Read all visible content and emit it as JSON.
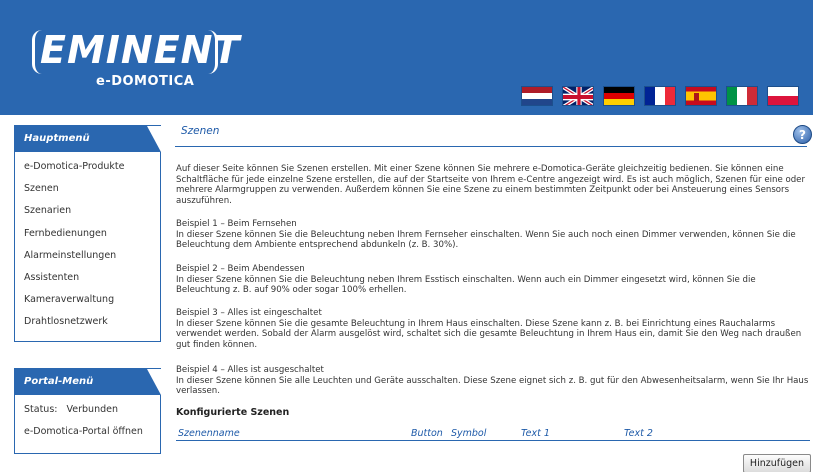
{
  "brand": {
    "logo_word": "EMINENT",
    "logo_sub": "e-DOMOTICA"
  },
  "flags": [
    {
      "name": "nl-flag"
    },
    {
      "name": "uk-flag"
    },
    {
      "name": "de-flag"
    },
    {
      "name": "fr-flag"
    },
    {
      "name": "es-flag"
    },
    {
      "name": "it-flag"
    },
    {
      "name": "pl-flag"
    }
  ],
  "main_menu": {
    "title": "Hauptmenü",
    "items": [
      "e-Domotica-Produkte",
      "Szenen",
      "Szenarien",
      "Fernbedienungen",
      "Alarmeinstellungen",
      "Assistenten",
      "Kameraverwaltung",
      "Drahtlosnetzwerk"
    ]
  },
  "portal_menu": {
    "title": "Portal-Menü",
    "status_label": "Status:",
    "status_value": "Verbunden",
    "open_portal": "e-Domotica-Portal öffnen"
  },
  "page": {
    "title": "Szenen",
    "help_icon": "?",
    "intro": "Auf dieser Seite können Sie Szenen erstellen. Mit einer Szene können Sie mehrere e-Domotica-Geräte gleichzeitig bedienen. Sie können eine Schaltfläche für jede einzelne Szene erstellen, die auf der Startseite von Ihrem e-Centre angezeigt wird. Es ist auch möglich, Szenen für eine oder mehrere Alarmgruppen zu verwenden. Außerdem können Sie eine Szene zu einem bestimmten Zeitpunkt oder bei Ansteuerung eines Sensors auszuführen.",
    "examples": [
      {
        "heading": "Beispiel 1 – Beim Fernsehen",
        "text": "In dieser Szene können Sie die Beleuchtung neben Ihrem Fernseher einschalten. Wenn Sie auch noch einen Dimmer verwenden, können Sie die Beleuchtung dem Ambiente entsprechend abdunkeln (z. B. 30%)."
      },
      {
        "heading": "Beispiel 2 – Beim Abendessen",
        "text": "In dieser Szene können Sie die Beleuchtung neben Ihrem Esstisch einschalten. Wenn auch ein Dimmer eingesetzt wird, können Sie die Beleuchtung z. B. auf 90% oder sogar 100% erhellen."
      },
      {
        "heading": "Beispiel 3 – Alles ist eingeschaltet",
        "text": "In dieser Szene können Sie die gesamte Beleuchtung in Ihrem Haus einschalten. Diese Szene kann z. B. bei Einrichtung eines Rauchalarms verwendet werden. Sobald der Alarm ausgelöst wird, schaltet sich die gesamte Beleuchtung in Ihrem Haus ein, damit Sie den Weg nach draußen gut finden können."
      },
      {
        "heading": "Beispiel 4 – Alles ist ausgeschaltet",
        "text": "In dieser Szene können Sie alle Leuchten und Geräte ausschalten. Diese Szene eignet sich z. B. gut für den Abwesenheitsalarm, wenn Sie Ihr Haus verlassen."
      }
    ],
    "configured_title": "Konfigurierte Szenen",
    "table_columns": [
      "Szenenname",
      "Button",
      "Symbol",
      "Text 1",
      "Text 2"
    ],
    "add_button": "Hinzufügen"
  }
}
